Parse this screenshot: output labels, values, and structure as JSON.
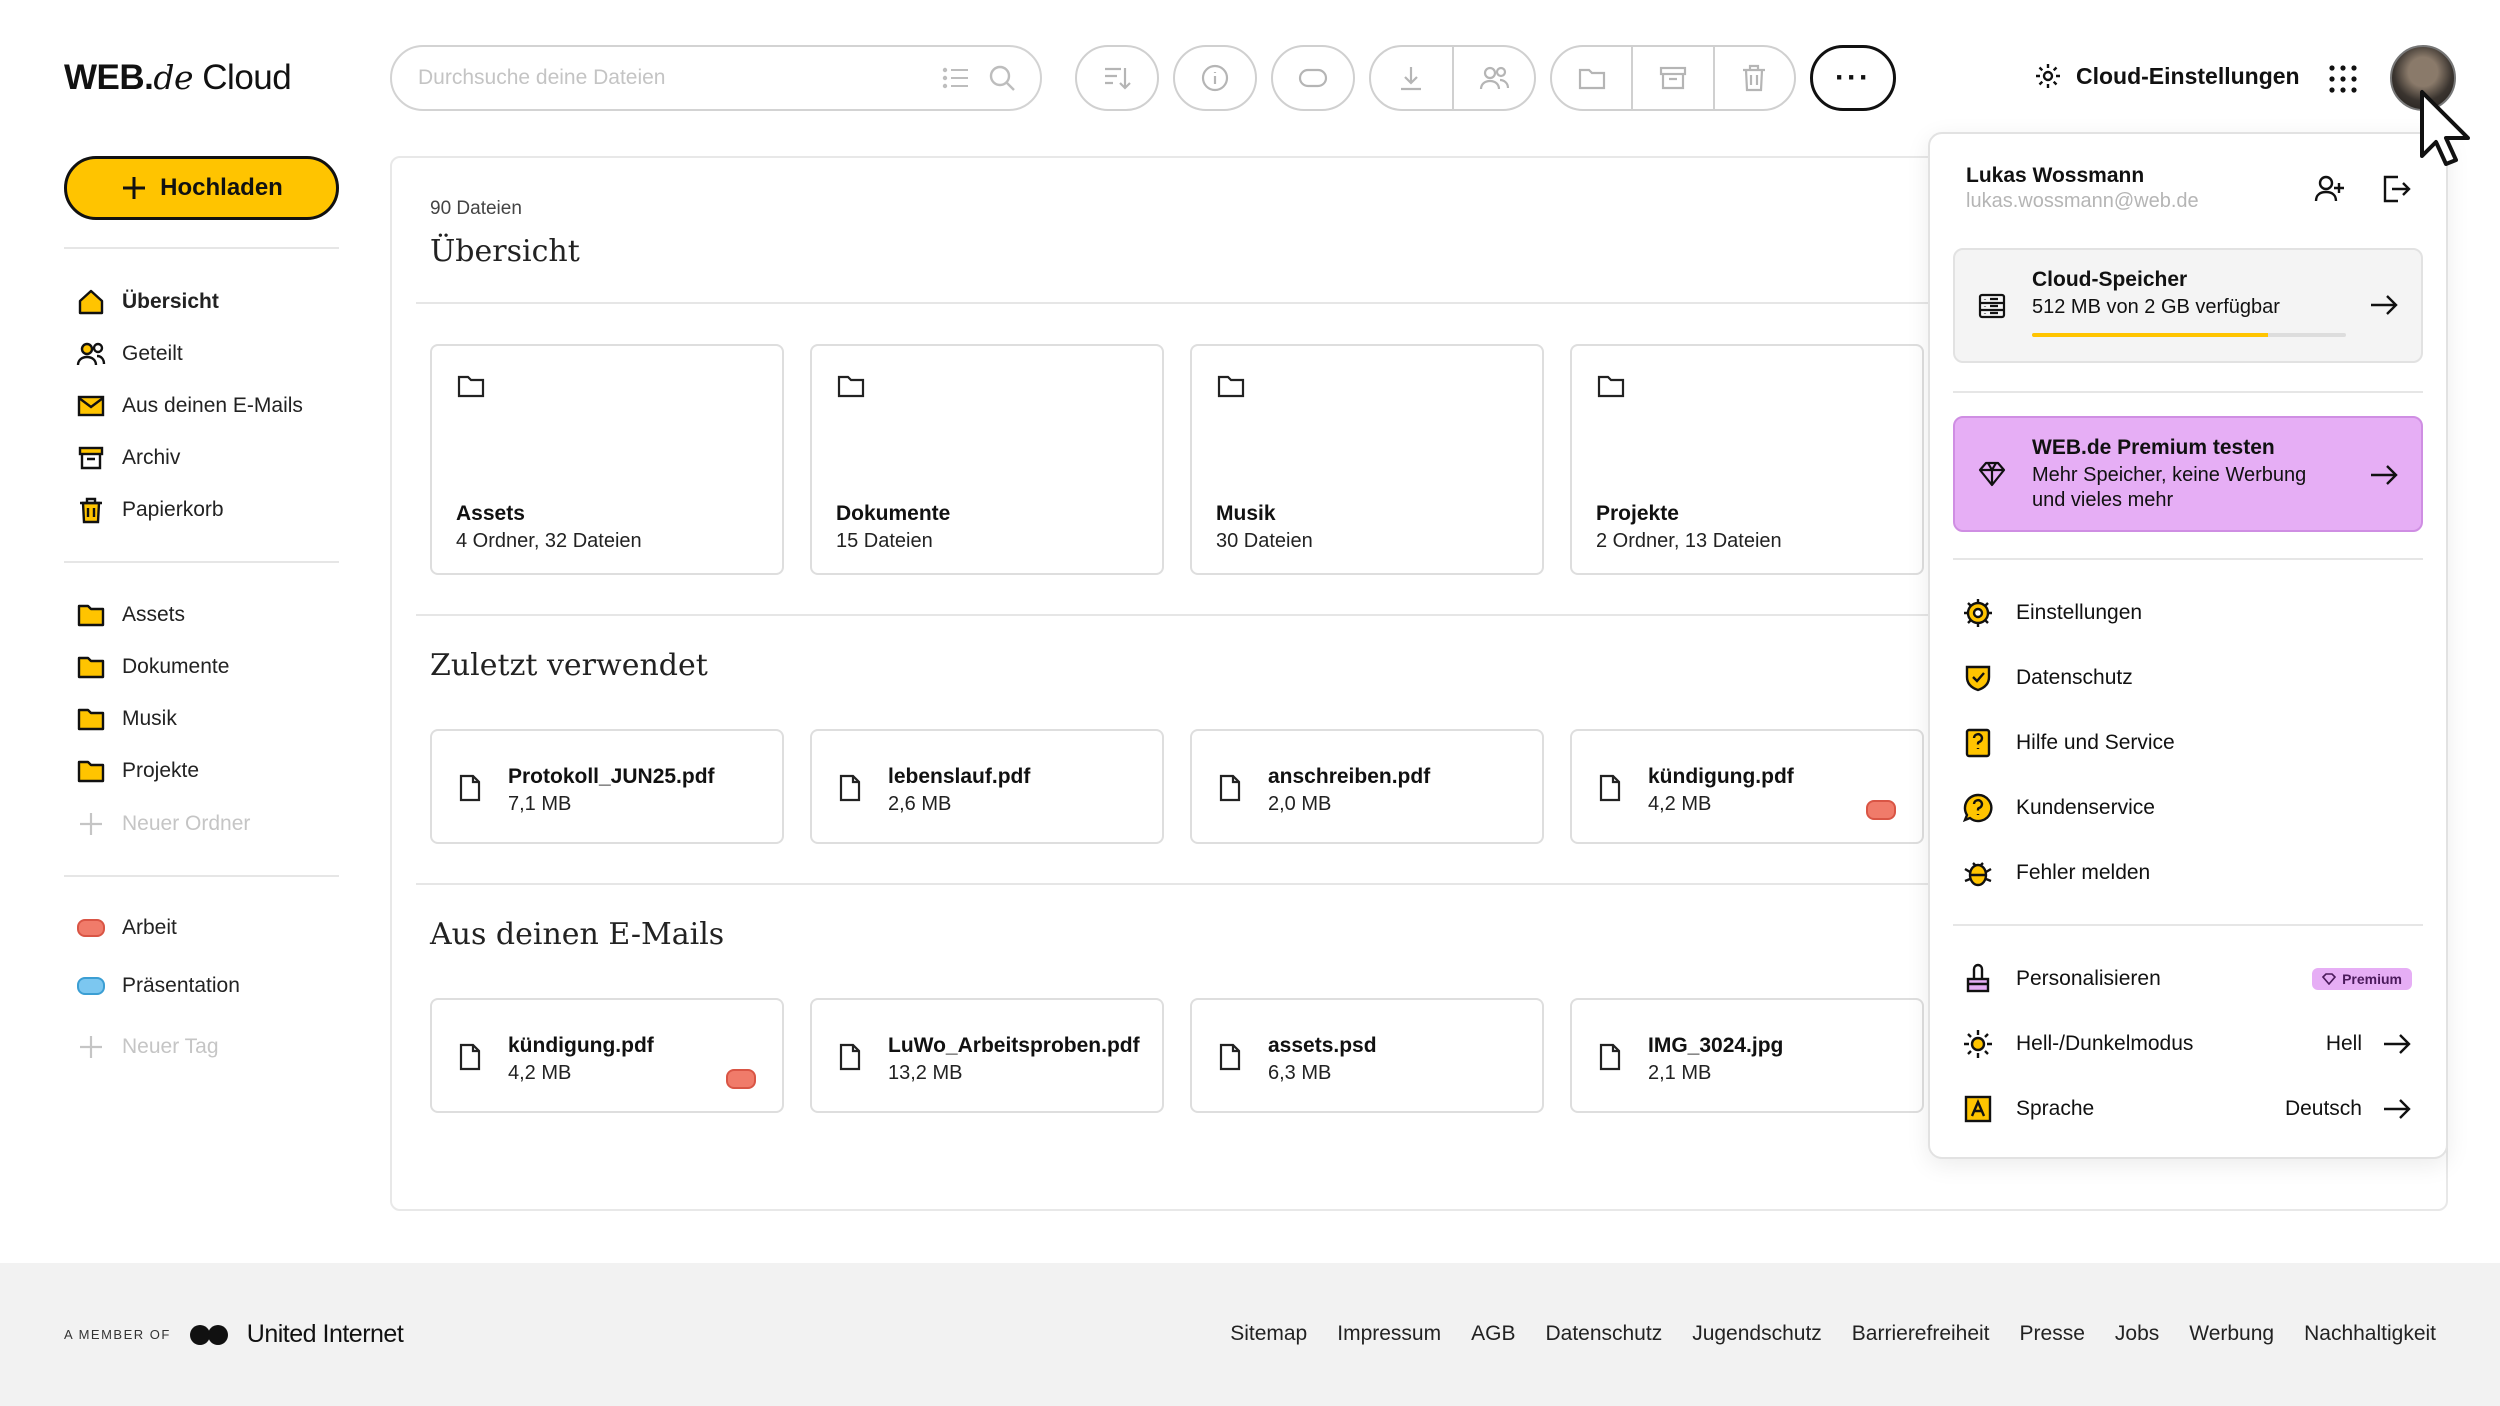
{
  "logo": {
    "brand": "WEB.",
    "de": "de",
    "cloud": "Cloud"
  },
  "search": {
    "placeholder": "Durchsuche deine Dateien"
  },
  "topbar": {
    "cloud_settings": "Cloud-Einstellungen",
    "more": "···"
  },
  "upload": {
    "label": "Hochladen"
  },
  "sidebar": {
    "main": [
      {
        "label": "Übersicht",
        "icon": "home-icon"
      },
      {
        "label": "Geteilt",
        "icon": "users-icon"
      },
      {
        "label": "Aus deinen E-Mails",
        "icon": "mail-icon"
      },
      {
        "label": "Archiv",
        "icon": "archive-icon"
      },
      {
        "label": "Papierkorb",
        "icon": "trash-icon"
      }
    ],
    "folders": [
      "Assets",
      "Dokumente",
      "Musik",
      "Projekte"
    ],
    "new_folder": "Neuer Ordner",
    "tags": [
      "Arbeit",
      "Präsentation"
    ],
    "new_tag": "Neuer Tag"
  },
  "main": {
    "count": "90 Dateien",
    "title": "Übersicht",
    "folders": [
      {
        "name": "Assets",
        "meta": "4 Ordner, 32 Dateien"
      },
      {
        "name": "Dokumente",
        "meta": "15 Dateien"
      },
      {
        "name": "Musik",
        "meta": "30 Dateien"
      },
      {
        "name": "Projekte",
        "meta": "2 Ordner, 13 Dateien"
      }
    ],
    "recent_title": "Zuletzt verwendet",
    "recent": [
      {
        "name": "Protokoll_JUN25.pdf",
        "size": "7,1 MB"
      },
      {
        "name": "lebenslauf.pdf",
        "size": "2,6 MB"
      },
      {
        "name": "anschreiben.pdf",
        "size": "2,0 MB"
      },
      {
        "name": "kündigung.pdf",
        "size": "4,2 MB"
      }
    ],
    "mails_title": "Aus deinen E-Mails",
    "mails": [
      {
        "name": "kündigung.pdf",
        "size": "4,2 MB"
      },
      {
        "name": "LuWo_Arbeitsproben.pdf",
        "size": "13,2 MB"
      },
      {
        "name": "assets.psd",
        "size": "6,3 MB"
      },
      {
        "name": "IMG_3024.jpg",
        "size": "2,1 MB"
      }
    ]
  },
  "account": {
    "name": "Lukas Wossmann",
    "email": "lukas.wossmann@web.de",
    "storage": {
      "title": "Cloud-Speicher",
      "detail": "512 MB von 2 GB verfügbar",
      "used_fraction": 0.75
    },
    "premium": {
      "title": "WEB.de Premium testen",
      "line1": "Mehr Speicher, keine Werbung",
      "line2": "und vieles mehr"
    },
    "menu1": [
      "Einstellungen",
      "Datenschutz",
      "Hilfe und Service",
      "Kundenservice",
      "Fehler melden"
    ],
    "personalize": "Personalisieren",
    "premium_badge": "Premium",
    "theme": {
      "label": "Hell-/Dunkelmodus",
      "value": "Hell"
    },
    "language": {
      "label": "Sprache",
      "value": "Deutsch"
    }
  },
  "footer": {
    "member": "A MEMBER OF",
    "company": "United Internet",
    "links": [
      "Sitemap",
      "Impressum",
      "AGB",
      "Datenschutz",
      "Jugendschutz",
      "Barrierefreiheit",
      "Presse",
      "Jobs",
      "Werbung",
      "Nachhaltigkeit"
    ]
  },
  "colors": {
    "accent": "#ffc400",
    "premium": "#e6aef5",
    "tag_red": "#f07b6a",
    "tag_blue": "#7cc7f0"
  }
}
